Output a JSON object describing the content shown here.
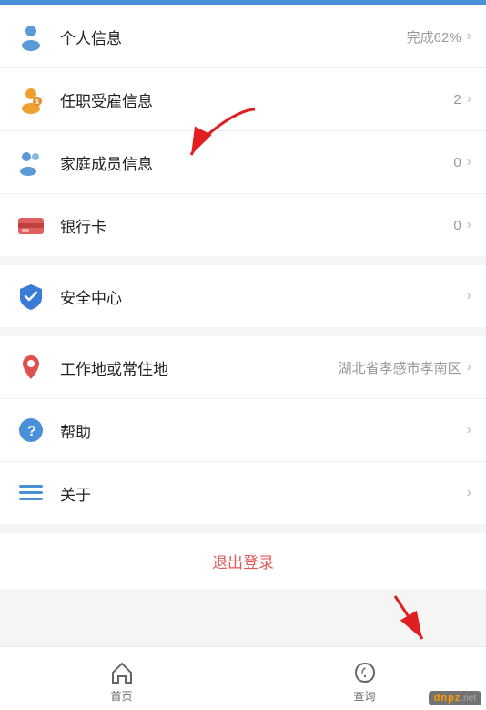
{
  "topbar": {
    "color": "#4A90D9"
  },
  "menu": {
    "sections": [
      {
        "id": "section1",
        "items": [
          {
            "id": "personal-info",
            "label": "个人信息",
            "value": "完成62%",
            "icon": "person",
            "has_chevron": true
          },
          {
            "id": "employment-info",
            "label": "任职受雇信息",
            "value": "2",
            "icon": "employ",
            "has_chevron": true
          },
          {
            "id": "family-info",
            "label": "家庭成员信息",
            "value": "0",
            "icon": "family",
            "has_chevron": true
          },
          {
            "id": "bank-card",
            "label": "银行卡",
            "value": "0",
            "icon": "bank",
            "has_chevron": true
          }
        ]
      },
      {
        "id": "section2",
        "items": [
          {
            "id": "security-center",
            "label": "安全中心",
            "value": "",
            "icon": "shield",
            "has_chevron": true
          }
        ]
      },
      {
        "id": "section3",
        "items": [
          {
            "id": "work-location",
            "label": "工作地或常住地",
            "value": "湖北省孝感市孝南区",
            "icon": "location",
            "has_chevron": true
          },
          {
            "id": "help",
            "label": "帮助",
            "value": "",
            "icon": "help",
            "has_chevron": true
          },
          {
            "id": "about",
            "label": "关于",
            "value": "",
            "icon": "about",
            "has_chevron": true
          }
        ]
      }
    ]
  },
  "logout": {
    "label": "退出登录"
  },
  "bottom_nav": {
    "items": [
      {
        "id": "home",
        "label": "首页",
        "active": false
      },
      {
        "id": "query",
        "label": "查询",
        "active": false
      }
    ]
  }
}
